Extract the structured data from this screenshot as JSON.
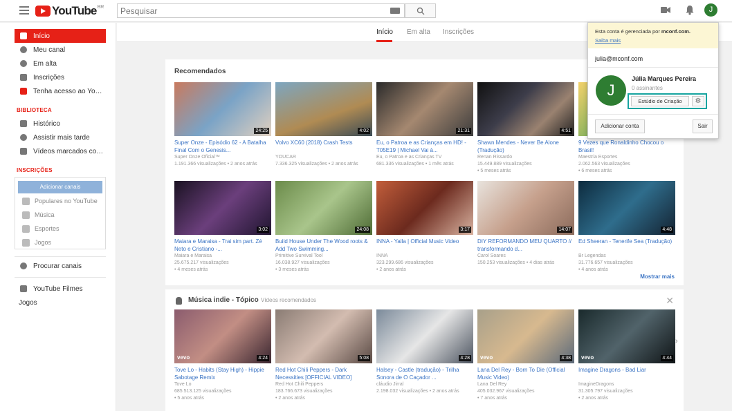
{
  "header": {
    "logo_text": "YouTube",
    "logo_region": "BR",
    "search_placeholder": "Pesquisar"
  },
  "colors": {
    "brand_red": "#e62117",
    "highlight_teal": "#16a4a0",
    "avatar_green": "#2e7d32"
  },
  "sidebar": {
    "main_items": [
      {
        "label": "Início",
        "icon": "home-icon",
        "active": true
      },
      {
        "label": "Meu canal",
        "icon": "account-icon"
      },
      {
        "label": "Em alta",
        "icon": "flame-icon"
      },
      {
        "label": "Inscrições",
        "icon": "subscriptions-icon"
      },
      {
        "label": "Tenha acesso ao YouTube Red",
        "icon": "youtube-red-icon"
      }
    ],
    "library_title": "BIBLIOTECA",
    "library_items": [
      {
        "label": "Histórico",
        "icon": "hourglass-icon"
      },
      {
        "label": "Assistir mais tarde",
        "icon": "clock-icon"
      },
      {
        "label": "Vídeos marcados com \"Gostei\"",
        "icon": "thumbs-up-icon"
      }
    ],
    "subscriptions_title": "INSCRIÇÕES",
    "add_channels": "Adicionar canais",
    "subscriptions": [
      "Populares no YouTube",
      "Música",
      "Esportes",
      "Jogos"
    ],
    "browse_channels": "Procurar canais",
    "youtube_movies": "YouTube Filmes",
    "games": "Jogos"
  },
  "tabs": [
    "Início",
    "Em alta",
    "Inscrições"
  ],
  "recommended": {
    "title": "Recomendados",
    "more_label": "Mostrar mais",
    "videos": [
      {
        "title": "Super Onze - Episódio 62 - A Batalha Final Com o Genesis...",
        "channel": "Super Onze Oficial™",
        "meta": "1.191.366 visualizações • 2 anos atrás",
        "duration": "24:25"
      },
      {
        "title": "Volvo XC60 (2018) Crash Tests",
        "channel": "YOUCAR",
        "meta": "7.336.325 visualizações • 2 anos atrás",
        "duration": "4:02"
      },
      {
        "title": "Eu, o Patroa e as Crianças em HD! - T05E19 | Michael Vai à...",
        "channel": "Eu, o Patroa e as Crianças TV",
        "meta": "681.336 visualizações • 1 mês atrás",
        "duration": "21:31"
      },
      {
        "title": "Shawn Mendes - Never Be Alone (Tradução)",
        "channel": "Renan Rissardo",
        "meta": "15.449.889 visualizações",
        "meta2": "• 5 meses atrás",
        "duration": "4:51"
      },
      {
        "title": "9 Vezes que Ronaldinho Chocou o Brasil!",
        "channel": "Maestria Esportes",
        "meta": "2.062.563 visualizações",
        "meta2": "• 6 meses atrás",
        "duration": ""
      },
      {
        "title": "Maiara e Maraisa - Trai sim part. Zé Neto e Cristiano -...",
        "channel": "Maiara e Maraisa",
        "meta": "25.675.217 visualizações",
        "meta2": "• 4 meses atrás",
        "duration": "3:02"
      },
      {
        "title": "Build House Under The Wood roots & Add Two Swimming...",
        "channel": "Primitive Survival Tool",
        "meta": "16.038.927 visualizações",
        "meta2": "• 3 meses atrás",
        "duration": "24:08"
      },
      {
        "title": "INNA - Yalla | Official Music Video",
        "channel": "INNA",
        "meta": "323.299.686 visualizações",
        "meta2": "• 2 anos atrás",
        "duration": "3:17"
      },
      {
        "title": "DIY REFORMANDO MEU QUARTO // transformando d...",
        "channel": "Carol Soares",
        "meta": "150.253 visualizações • 4 dias atrás",
        "duration": "14:07"
      },
      {
        "title": "Ed Sheeran - Tenerife Sea (Tradução)",
        "channel": "Br Legendas",
        "meta": "31.776.657 visualizações",
        "meta2": "• 4 anos atrás",
        "duration": "4:48"
      }
    ]
  },
  "topic": {
    "title": "Música indie - Tópico",
    "subtitle": "Vídeos recomendados",
    "close": "✕",
    "videos": [
      {
        "title": "Tove Lo - Habits (Stay High) - Hippie Sabotage Remix",
        "channel": "Tove Lo",
        "meta": "685.513.125 visualizações",
        "meta2": "• 5 anos atrás",
        "duration": "4:24"
      },
      {
        "title": "Red Hot Chili Peppers - Dark Necessities [OFFICIAL VIDEO]",
        "channel": "Red Hot Chili Peppers",
        "meta": "183.766.673 visualizações",
        "meta2": "• 2 anos atrás",
        "duration": "5:08"
      },
      {
        "title": "Halsey - Castle (tradução) - Trilha Sonora de O Caçador ...",
        "channel": "cláudio Jirral",
        "meta": "2.198.032 visualizações • 2 anos atrás",
        "duration": "4:28"
      },
      {
        "title": "Lana Del Rey - Born To Die (Official Music Video)",
        "channel": "Lana Del Rey",
        "meta": "405.032.967 visualizações",
        "meta2": "• 7 anos atrás",
        "duration": "4:38"
      },
      {
        "title": "Imagine Dragons - Bad Liar",
        "channel": "ImagineDragons",
        "meta": "31.305.797 visualizações",
        "meta2": "• 2 anos atrás",
        "duration": "4:44"
      }
    ]
  },
  "account": {
    "managed_text": "Esta conta é gerenciada por",
    "managed_domain": "mconf.com.",
    "learn_more": "Saiba mais",
    "email": "julia@mconf.com",
    "avatar_letter": "J",
    "name": "Júlia Marques Pereira",
    "subscribers": "0 assinantes",
    "studio": "Estúdio de Criação",
    "add_account": "Adicionar conta",
    "sign_out": "Sair"
  }
}
